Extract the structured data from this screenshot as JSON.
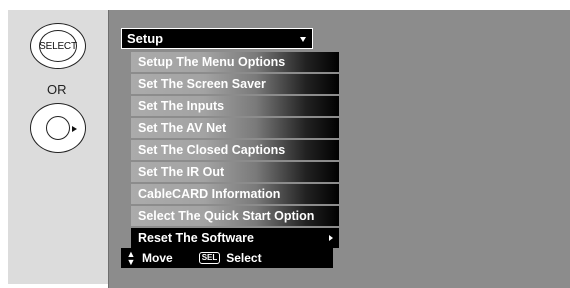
{
  "remote": {
    "select_button_label": "SELECT",
    "or_label": "OR"
  },
  "menu": {
    "title": "Setup",
    "items": [
      {
        "label": "Setup The Menu Options"
      },
      {
        "label": "Set The Screen Saver"
      },
      {
        "label": "Set The Inputs"
      },
      {
        "label": "Set The AV Net"
      },
      {
        "label": "Set The Closed Captions"
      },
      {
        "label": "Set The IR Out"
      },
      {
        "label": "CableCARD Information"
      },
      {
        "label": "Select The Quick Start Option"
      },
      {
        "label": "Reset The Software",
        "selected": true
      }
    ]
  },
  "hints": {
    "move_label": "Move",
    "sel_badge": "SEL",
    "select_label": "Select"
  },
  "colors": {
    "menu_bg": "#000000",
    "screen_bg": "#8c8c8c",
    "frame_bg": "#dcdcdc"
  },
  "icons": [
    "select-button-icon",
    "joystick-icon",
    "up-down-arrows-icon",
    "submenu-arrow-icon",
    "dropdown-arrow-icon"
  ]
}
